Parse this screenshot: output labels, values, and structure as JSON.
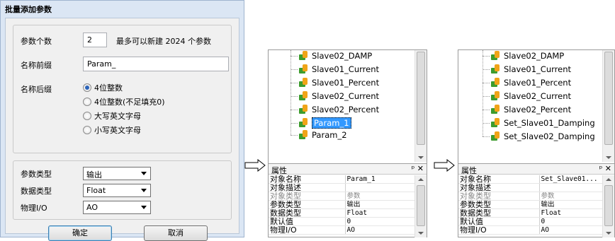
{
  "dialog": {
    "title": "批量添加参数",
    "count_label": "参数个数",
    "count_value": "2",
    "count_hint": "最多可以新建 2024 个参数",
    "prefix_label": "名称前缀",
    "prefix_value": "Param_",
    "suffix_label": "名称后缀",
    "suffix_options": [
      "4位整数",
      "4位整数(不足填充0)",
      "大写英文字母",
      "小写英文字母"
    ],
    "suffix_selected": 0,
    "param_type_label": "参数类型",
    "param_type_value": "输出",
    "data_type_label": "数据类型",
    "data_type_value": "Float",
    "physical_io_label": "物理I/O",
    "physical_io_value": "AO",
    "ok_label": "确定",
    "cancel_label": "取消"
  },
  "panel1": {
    "tree_items": [
      "Slave02_DAMP",
      "Slave01_Current",
      "Slave01_Percent",
      "Slave02_Current",
      "Slave02_Percent",
      "Param_1",
      "Param_2"
    ],
    "selected_index": 5,
    "props_title": "属性",
    "props_icons": "ᵖ ✕",
    "props": [
      {
        "key": "对象名称",
        "value": "Param_1",
        "readonly": false
      },
      {
        "key": "对象描述",
        "value": "",
        "readonly": false
      },
      {
        "key": "对象类型",
        "value": "参数",
        "readonly": true
      },
      {
        "key": "参数类型",
        "value": "输出",
        "readonly": false
      },
      {
        "key": "数据类型",
        "value": "Float",
        "readonly": false
      },
      {
        "key": "默认值",
        "value": "0",
        "readonly": false
      },
      {
        "key": "物理I/O",
        "value": "AO",
        "readonly": false
      }
    ]
  },
  "panel2": {
    "tree_items": [
      "Slave02_DAMP",
      "Slave01_Current",
      "Slave01_Percent",
      "Slave02_Current",
      "Slave02_Percent",
      "Set_Slave01_Damping",
      "Set_Slave02_Damping"
    ],
    "selected_index": -1,
    "props_title": "属性",
    "props_icons": "ᵖ ✕",
    "props": [
      {
        "key": "对象名称",
        "value": "Set_Slave01...",
        "readonly": false
      },
      {
        "key": "对象描述",
        "value": "",
        "readonly": false
      },
      {
        "key": "对象类型",
        "value": "参数",
        "readonly": true
      },
      {
        "key": "参数类型",
        "value": "输出",
        "readonly": false
      },
      {
        "key": "数据类型",
        "value": "Float",
        "readonly": false
      },
      {
        "key": "默认值",
        "value": "0",
        "readonly": false
      },
      {
        "key": "物理I/O",
        "value": "AO",
        "readonly": false
      }
    ]
  }
}
